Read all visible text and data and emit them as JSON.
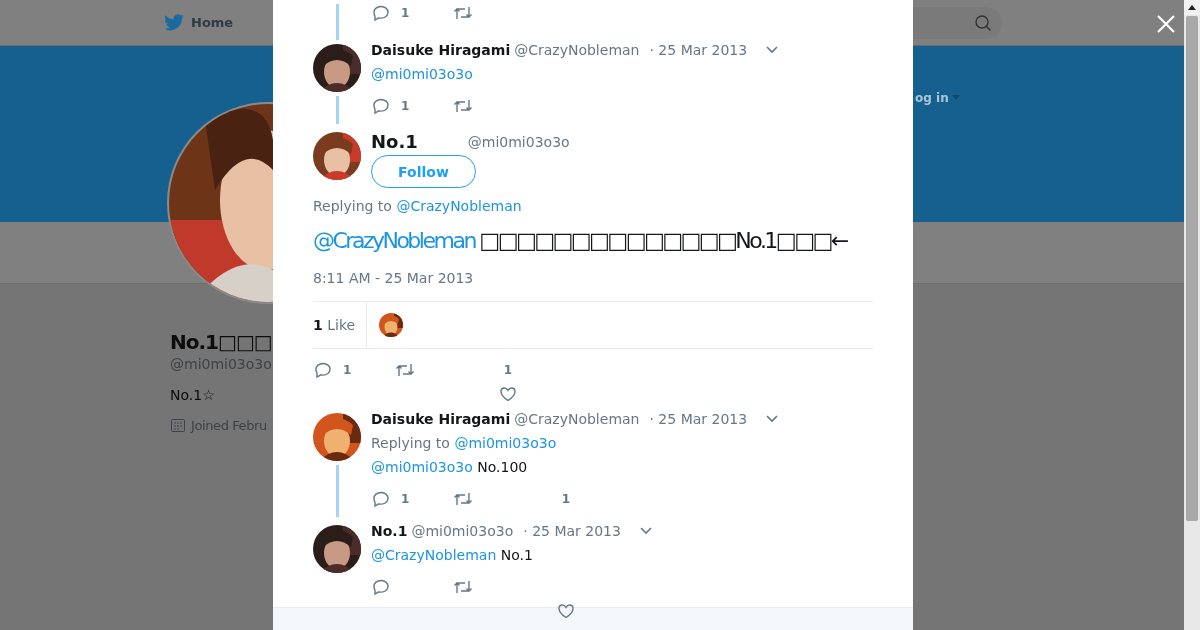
{
  "nav": {
    "home": "Home",
    "login": "og in"
  },
  "profile": {
    "name": "No.1□□□",
    "handle": "@mi0mi03o3o",
    "bio": "No.1☆",
    "joined": "Joined Febru"
  },
  "thread_top": {
    "replies": "1",
    "heart": false
  },
  "tweets": [
    {
      "kind": "reply",
      "name": "Daisuke Hiragami",
      "handle": "@CrazyNobleman",
      "date": "· 25 Mar 2013",
      "mention": "@mi0mi03o3o",
      "line_below": true,
      "actions": {
        "replies": "1",
        "heart": false
      }
    },
    {
      "kind": "main",
      "name": "No.1",
      "handle": "@mi0mi03o3o",
      "follow": "Follow",
      "replying_label": "Replying to",
      "replying_to": "@CrazyNobleman",
      "mention": "@CrazyNobleman",
      "text": "□□□□□□□□□□□□□□No.1□□□←",
      "time": "8:11 AM - 25 Mar 2013",
      "likes_summary": "**1** Like",
      "actions": {
        "replies": "1",
        "likes": "1",
        "heart": true
      }
    },
    {
      "kind": "reply",
      "name": "Daisuke Hiragami",
      "handle": "@CrazyNobleman",
      "date": "· 25 Mar 2013",
      "replying_label": "Replying to",
      "replying_to": "@mi0mi03o3o",
      "mention": "@mi0mi03o3o",
      "text": "No.100",
      "line_below": true,
      "actions": {
        "replies": "1",
        "likes": "1",
        "heart": false
      }
    },
    {
      "kind": "reply",
      "name": "No.1",
      "handle": "@mi0mi03o3o",
      "date": "· 25 Mar 2013",
      "mention": "@CrazyNobleman",
      "text": "No.1",
      "line_below": false,
      "actions": {
        "heart": true
      }
    }
  ]
}
